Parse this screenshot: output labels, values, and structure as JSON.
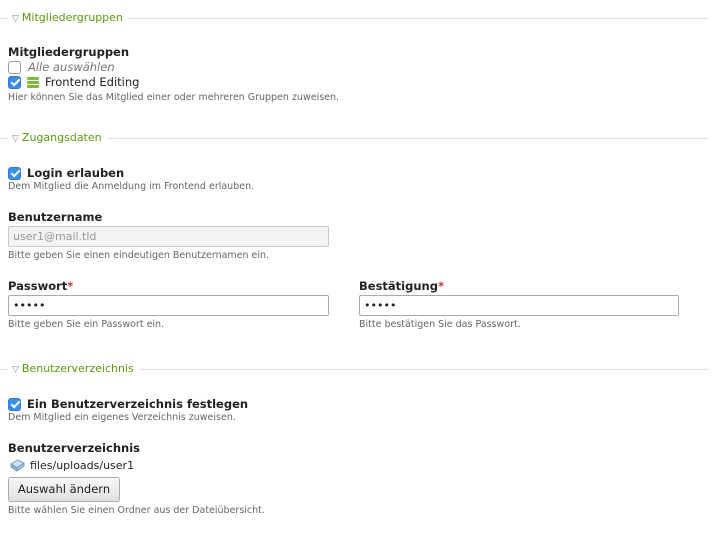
{
  "sections": {
    "groups": {
      "legend": "Mitgliedergruppen",
      "heading": "Mitgliedergruppen",
      "select_all": "Alle auswählen",
      "select_all_checked": false,
      "items": [
        {
          "label": "Frontend Editing",
          "checked": true,
          "icon": "member-group-icon"
        }
      ],
      "tip": "Hier können Sie das Mitglied einer oder mehreren Gruppen zuweisen."
    },
    "access": {
      "legend": "Zugangsdaten",
      "login": {
        "label": "Login erlauben",
        "checked": true,
        "tip": "Dem Mitglied die Anmeldung im Frontend erlauben."
      },
      "username": {
        "label": "Benutzername",
        "value": "user1@mail.tld",
        "tip": "Bitte geben Sie einen eindeutigen Benutzernamen ein."
      },
      "password": {
        "label": "Passwort",
        "required_mark": "*",
        "value": "•••••",
        "tip": "Bitte geben Sie ein Passwort ein."
      },
      "confirm": {
        "label": "Bestätigung",
        "required_mark": "*",
        "value": "•••••",
        "tip": "Bitte bestätigen Sie das Passwort."
      }
    },
    "homedir": {
      "legend": "Benutzerverzeichnis",
      "assign": {
        "label": "Ein Benutzerverzeichnis festlegen",
        "checked": true,
        "tip": "Dem Mitglied ein eigenes Verzeichnis zuweisen."
      },
      "dir": {
        "label": "Benutzerverzeichnis",
        "path": "files/uploads/user1",
        "icon": "folder-icon",
        "button": "Auswahl ändern",
        "tip": "Bitte wählen Sie einen Ordner aus der Dateiübersicht."
      }
    }
  },
  "colors": {
    "legend": "#589b0e",
    "checkbox": "#3b8ef0",
    "required": "#cc3333"
  }
}
